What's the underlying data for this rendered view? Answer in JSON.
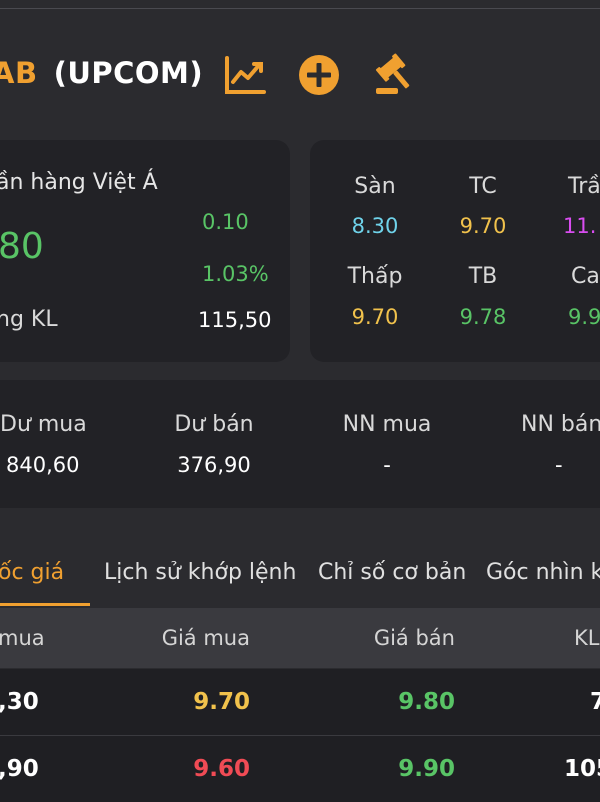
{
  "header": {
    "code": "AB",
    "exchange": "(UPCOM)",
    "icons": [
      "chart-line-icon",
      "plus-circle-icon",
      "auction-gavel-icon"
    ],
    "accent": "#f0a030"
  },
  "summary": {
    "company": "ần hàng Việt Á",
    "price": "80",
    "change": "0.10",
    "change_pct": "1.03%",
    "volume_label": "ng KL",
    "volume": "115,50"
  },
  "prices": {
    "floor_label": "Sàn",
    "floor": "8.30",
    "ref_label": "TC",
    "ref": "9.70",
    "ceil_label": "Trầ",
    "ceil": "11.",
    "low_label": "Thấp",
    "low": "9.70",
    "avg_label": "TB",
    "avg": "9.78",
    "high_label": "Ca",
    "high": "9.9"
  },
  "orders": {
    "buy_label": "Dư mua",
    "buy": "840,60",
    "sell_label": "Dư bán",
    "sell": "376,90",
    "foreign_buy_label": "NN mua",
    "foreign_buy": "-",
    "foreign_sell_label": "NN bán",
    "foreign_sell": "-"
  },
  "tabs": [
    {
      "label": "ốc giá",
      "active": true
    },
    {
      "label": "Lịch sử khớp lệnh",
      "active": false
    },
    {
      "label": "Chỉ số cơ bản",
      "active": false
    },
    {
      "label": "Góc nhìn kỹ",
      "active": false
    }
  ],
  "table": {
    "headers": [
      "mua",
      "Giá mua",
      "Giá bán",
      "KL"
    ],
    "rows": [
      [
        "30",
        "9.70",
        "9.80",
        "7"
      ],
      [
        "90",
        "9.60",
        "9.90",
        "105"
      ]
    ],
    "row_prefix": ","
  }
}
